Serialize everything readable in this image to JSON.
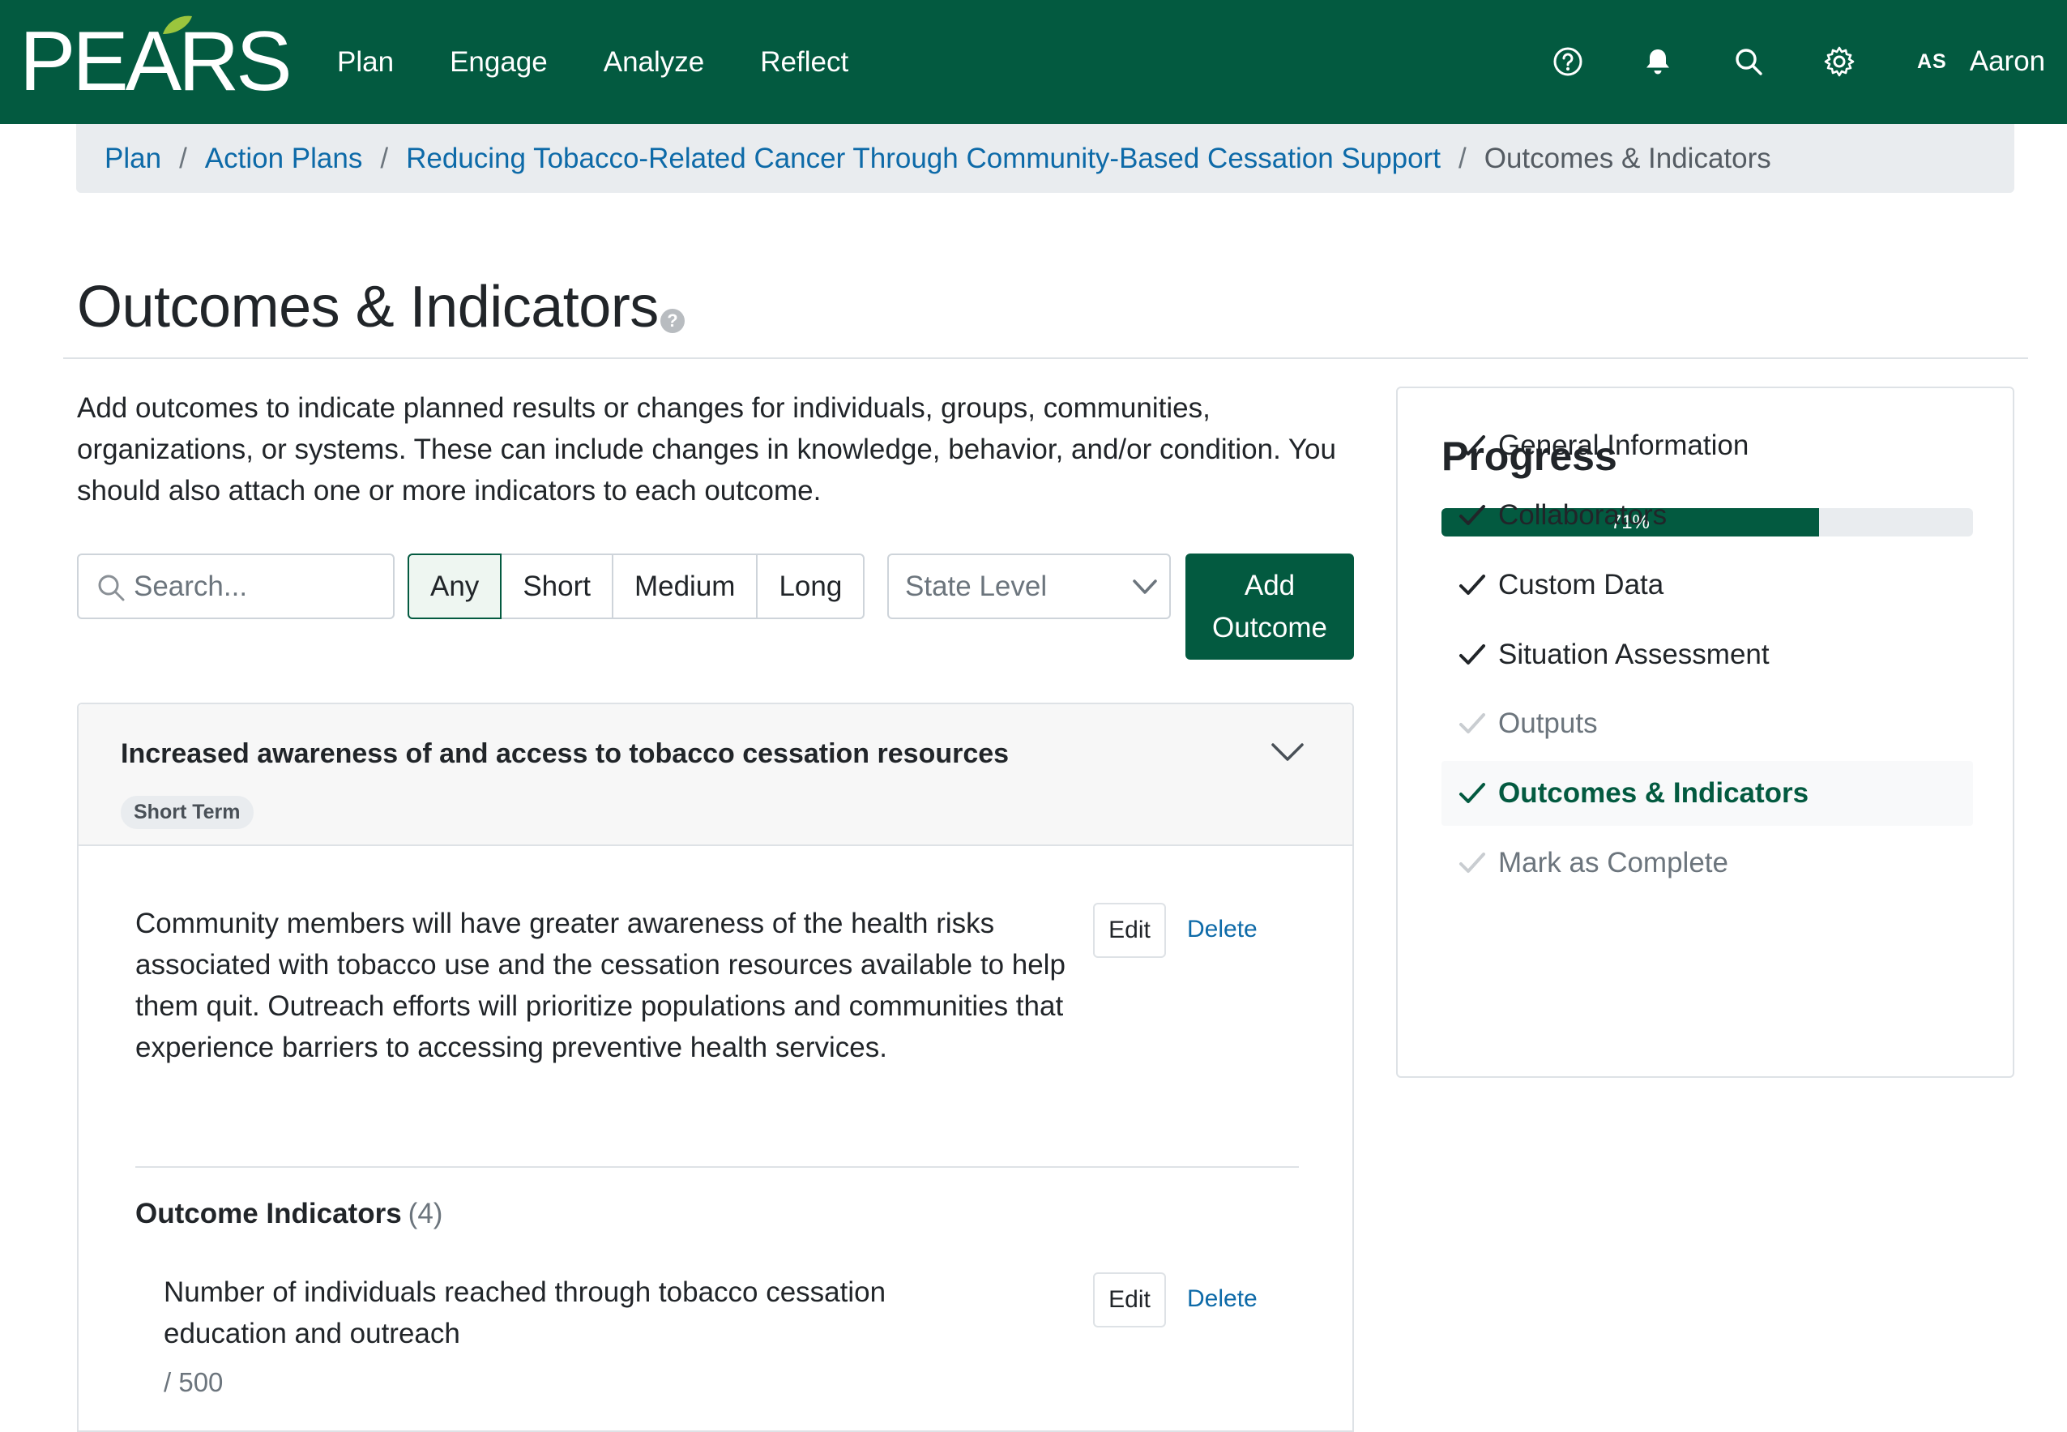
{
  "app": {
    "logo_text": "PEARS",
    "nav": [
      "Plan",
      "Engage",
      "Analyze",
      "Reflect"
    ],
    "user": {
      "initials": "AS",
      "name": "Aaron"
    },
    "icons": [
      "help-icon",
      "bell-icon",
      "search-icon",
      "gear-icon"
    ]
  },
  "breadcrumb": {
    "items": [
      "Plan",
      "Action Plans",
      "Reducing Tobacco-Related Cancer Through Community-Based Cessation Support"
    ],
    "current": "Outcomes & Indicators",
    "separator": "/"
  },
  "page": {
    "title": "Outcomes & Indicators",
    "help_glyph": "?",
    "intro": "Add outcomes to indicate planned results or changes for individuals, groups, communities, organizations, or systems. These can include changes in knowledge, behavior, and/or condition. You should also attach one or more indicators to each outcome."
  },
  "toolbar": {
    "search_placeholder": "Search...",
    "term_filters": [
      "Any",
      "Short",
      "Medium",
      "Long"
    ],
    "active_filter": "Any",
    "level_select": "State Level",
    "add_button": "Add Outcome"
  },
  "outcome": {
    "title": "Increased awareness of and access to tobacco cessation resources",
    "term_badge": "Short Term",
    "description": "Community members will have greater awareness of the health risks associated with tobacco use and the cessation resources available to help them quit. Outreach efforts will prioritize populations and communities that experience barriers to accessing preventive health services.",
    "edit_label": "Edit",
    "delete_label": "Delete",
    "indicators_heading": "Outcome Indicators",
    "indicators_count": "(4)",
    "indicators": [
      {
        "description": "Number of individuals reached through tobacco cessation education and outreach",
        "target": "/ 500",
        "edit_label": "Edit",
        "delete_label": "Delete"
      }
    ]
  },
  "progress": {
    "title": "Progress",
    "percent": 71,
    "percent_label": "71%",
    "steps": [
      {
        "label": "General Information",
        "status": "done"
      },
      {
        "label": "Collaborators",
        "status": "done"
      },
      {
        "label": "Custom Data",
        "status": "done"
      },
      {
        "label": "Situation Assessment",
        "status": "done"
      },
      {
        "label": "Outputs",
        "status": "pending"
      },
      {
        "label": "Outcomes & Indicators",
        "status": "active"
      },
      {
        "label": "Mark as Complete",
        "status": "pending"
      }
    ]
  },
  "colors": {
    "brand": "#035a40",
    "link": "#0d6aa8",
    "breadcrumb_bg": "#e9ecef"
  }
}
